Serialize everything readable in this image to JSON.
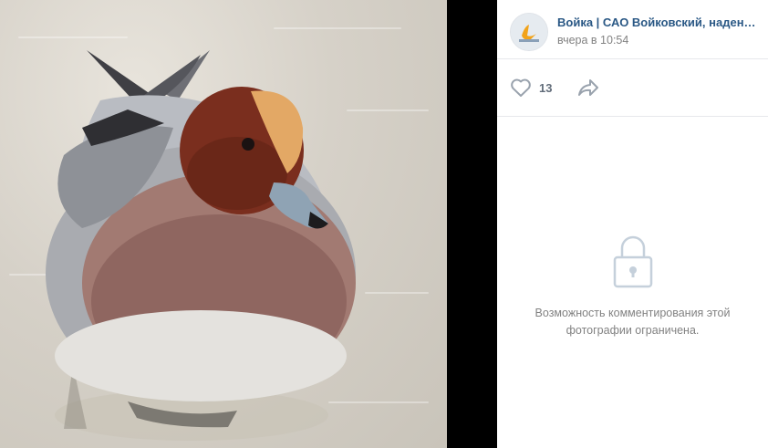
{
  "post": {
    "author": "Войка | САО Войковский, надень м...",
    "date": "вчера в 10:54",
    "avatar_icon": "community-logo-icon"
  },
  "actions": {
    "like_count": "13",
    "like_icon": "heart-icon",
    "share_icon": "share-arrow-icon"
  },
  "comments": {
    "lock_icon": "lock-icon",
    "restricted_text": "Возможность комментирования этой фотографии ограничена."
  },
  "colors": {
    "link": "#2a5885",
    "muted": "#828282",
    "icon": "#99a2ad",
    "accent_orange": "#f2a31a"
  }
}
